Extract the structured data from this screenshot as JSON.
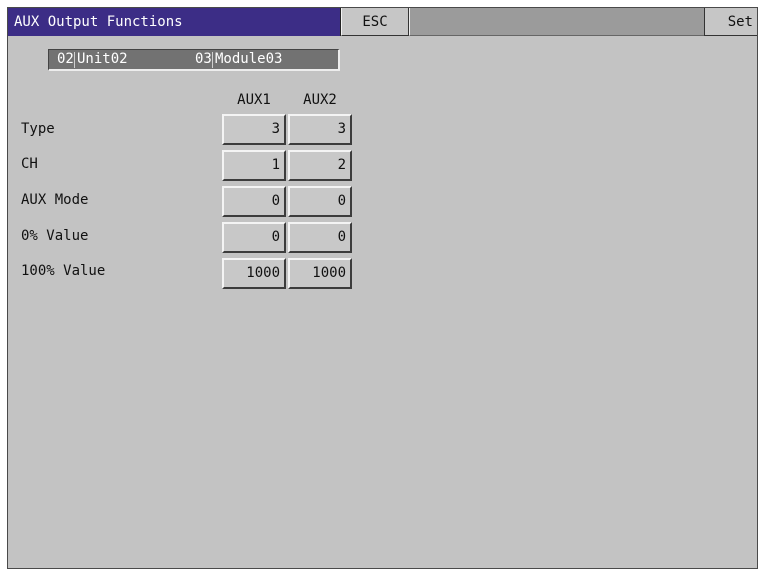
{
  "window": {
    "title": "AUX Output Functions",
    "esc_label": "ESC",
    "set_label": "Set"
  },
  "selector": {
    "unit_number": "02",
    "unit_name": "Unit02",
    "module_number": "03",
    "module_name": "Module03"
  },
  "table": {
    "columns": [
      "AUX1",
      "AUX2"
    ],
    "rows": [
      {
        "label": "Type",
        "values": [
          "3",
          "3"
        ]
      },
      {
        "label": "CH",
        "values": [
          "1",
          "2"
        ]
      },
      {
        "label": "AUX Mode",
        "values": [
          "0",
          "0"
        ]
      },
      {
        "label": "0% Value",
        "values": [
          "0",
          "0"
        ]
      },
      {
        "label": "100% Value",
        "values": [
          "1000",
          "1000"
        ]
      }
    ]
  },
  "colors": {
    "title_bar": "#3c2d86",
    "background": "#c3c3c3",
    "selector_bar": "#727272"
  }
}
